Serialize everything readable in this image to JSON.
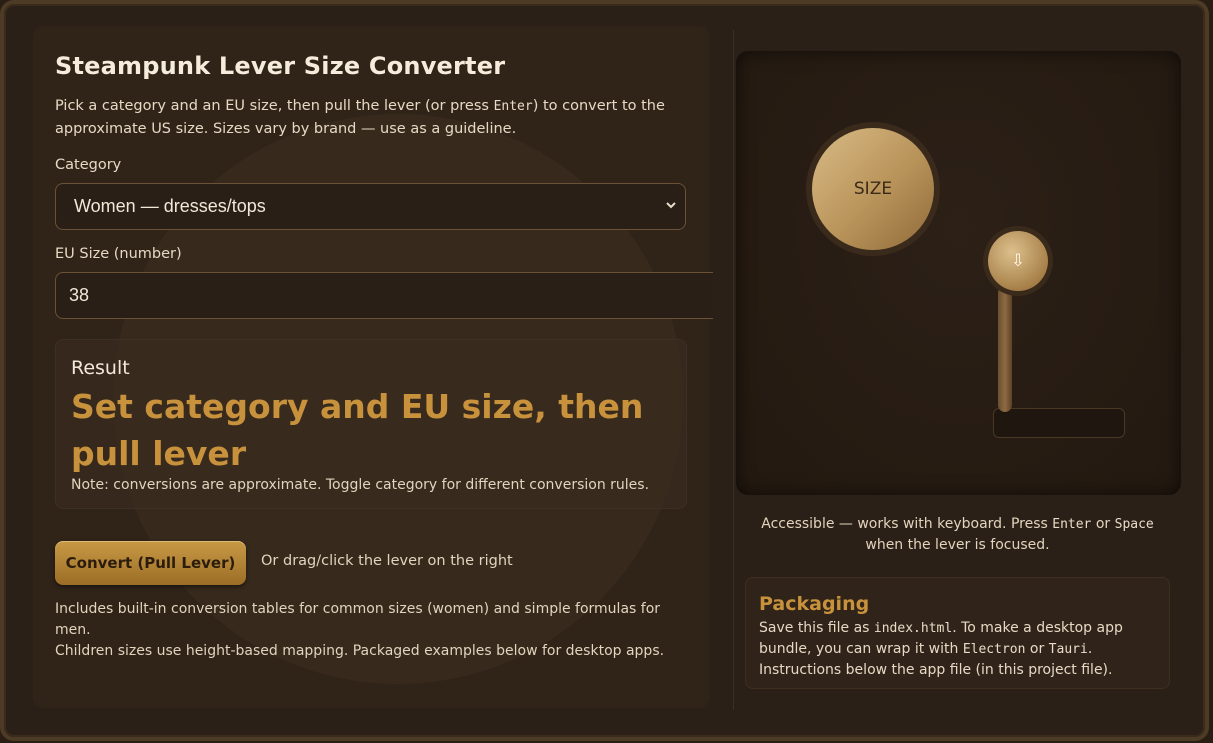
{
  "app": {
    "title": "Steampunk Lever Size Converter",
    "subtitle_pre": "Pick a category and an EU size, then pull the lever (or press ",
    "subtitle_key": "Enter",
    "subtitle_post": ") to convert to the approximate US size. Sizes vary by brand — use as a guideline."
  },
  "form": {
    "category_label": "Category",
    "category_value": "Women — dresses/tops",
    "eu_label": "EU Size (number)",
    "eu_value": "38"
  },
  "result": {
    "heading": "Result",
    "value": "Set category and EU size, then pull lever",
    "note": "Note: conversions are approximate. Toggle category for different conversion rules."
  },
  "actions": {
    "convert_label": "Convert (Pull Lever)",
    "hint": "Or drag/click the lever on the right"
  },
  "info": {
    "line1": "Includes built-in conversion tables for common sizes (women) and simple formulas for men.",
    "line2": "Children sizes use height-based mapping. Packaged examples below for desktop apps."
  },
  "machine": {
    "dial_label": "SIZE",
    "lever_glyph": "⇩"
  },
  "accessibility": {
    "pre": "Accessible — works with keyboard. Press ",
    "key1": "Enter",
    "mid": " or ",
    "key2": "Space",
    "post": "when the lever is focused."
  },
  "packaging": {
    "title": "Packaging",
    "t1": "Save this file as ",
    "file": "index.html",
    "t2": ". To make a desktop app bundle, you can wrap it with ",
    "electron": "Electron",
    "t3": " or ",
    "tauri": "Tauri",
    "t4": ". Instructions below the app file (in this project file)."
  }
}
